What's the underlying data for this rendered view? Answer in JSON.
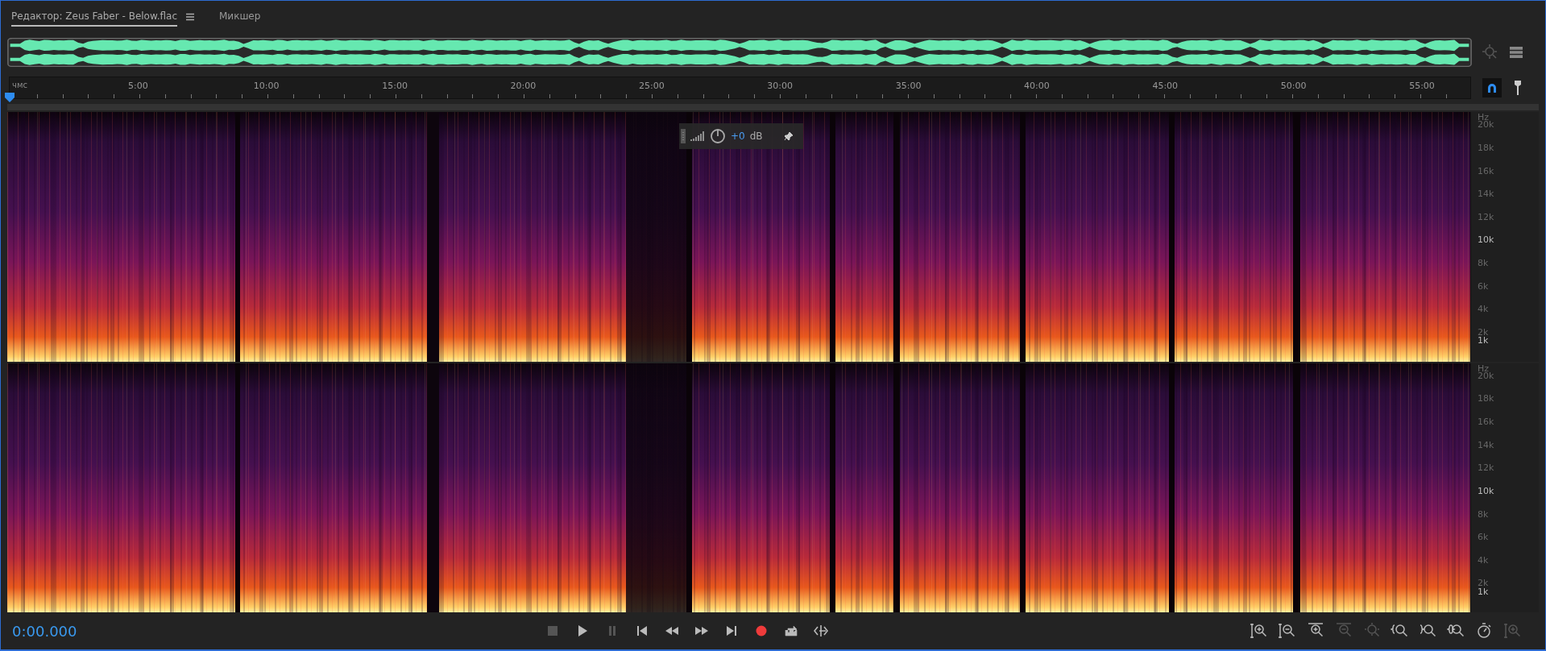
{
  "tabs": [
    {
      "label": "Редактор: Zeus Faber - Below.flac",
      "selected": true,
      "menu": true
    },
    {
      "label": "Микшер",
      "selected": false,
      "menu": false
    }
  ],
  "ruler": {
    "unit": "чмс",
    "labels": [
      "5:00",
      "10:00",
      "15:00",
      "20:00",
      "25:00",
      "30:00",
      "35:00",
      "40:00",
      "45:00",
      "50:00",
      "55:00"
    ]
  },
  "snap": {
    "on": true
  },
  "hud": {
    "value": "+0",
    "unit": "dB"
  },
  "channels": [
    {
      "axis": [
        {
          "label": "Hz",
          "major": false
        },
        {
          "label": "20k",
          "major": false
        },
        {
          "label": "18k",
          "major": false
        },
        {
          "label": "16k",
          "major": false
        },
        {
          "label": "14k",
          "major": false
        },
        {
          "label": "12k",
          "major": false
        },
        {
          "label": "10k",
          "major": true
        },
        {
          "label": "8k",
          "major": false
        },
        {
          "label": "6k",
          "major": false
        },
        {
          "label": "4k",
          "major": false
        },
        {
          "label": "2k",
          "major": false
        },
        {
          "label": "1k",
          "major": true
        }
      ]
    },
    {
      "axis": [
        {
          "label": "Hz",
          "major": false
        },
        {
          "label": "20k",
          "major": false
        },
        {
          "label": "18k",
          "major": false
        },
        {
          "label": "16k",
          "major": false
        },
        {
          "label": "14k",
          "major": false
        },
        {
          "label": "12k",
          "major": false
        },
        {
          "label": "10k",
          "major": true
        },
        {
          "label": "8k",
          "major": false
        },
        {
          "label": "6k",
          "major": false
        },
        {
          "label": "4k",
          "major": false
        },
        {
          "label": "2k",
          "major": false
        },
        {
          "label": "1k",
          "major": true
        }
      ]
    }
  ],
  "time": "0:00.000",
  "transport": [
    {
      "kind": "stop",
      "disabled": true
    },
    {
      "kind": "play",
      "disabled": false
    },
    {
      "kind": "pause",
      "disabled": true
    },
    {
      "kind": "start",
      "disabled": false
    },
    {
      "kind": "rewind",
      "disabled": false
    },
    {
      "kind": "forward",
      "disabled": false
    },
    {
      "kind": "end",
      "disabled": false
    },
    {
      "kind": "record",
      "disabled": false
    },
    {
      "kind": "loop",
      "disabled": false
    },
    {
      "kind": "skip",
      "disabled": false
    }
  ],
  "zoom": [
    {
      "kind": "amp-in",
      "disabled": false
    },
    {
      "kind": "amp-out",
      "disabled": false
    },
    {
      "kind": "time-in",
      "disabled": false
    },
    {
      "kind": "time-out",
      "disabled": true
    },
    {
      "kind": "full",
      "disabled": true
    },
    {
      "kind": "left",
      "disabled": false
    },
    {
      "kind": "right",
      "disabled": false
    },
    {
      "kind": "both",
      "disabled": false
    },
    {
      "kind": "timer",
      "disabled": false
    },
    {
      "kind": "amp-in",
      "disabled": true
    }
  ]
}
